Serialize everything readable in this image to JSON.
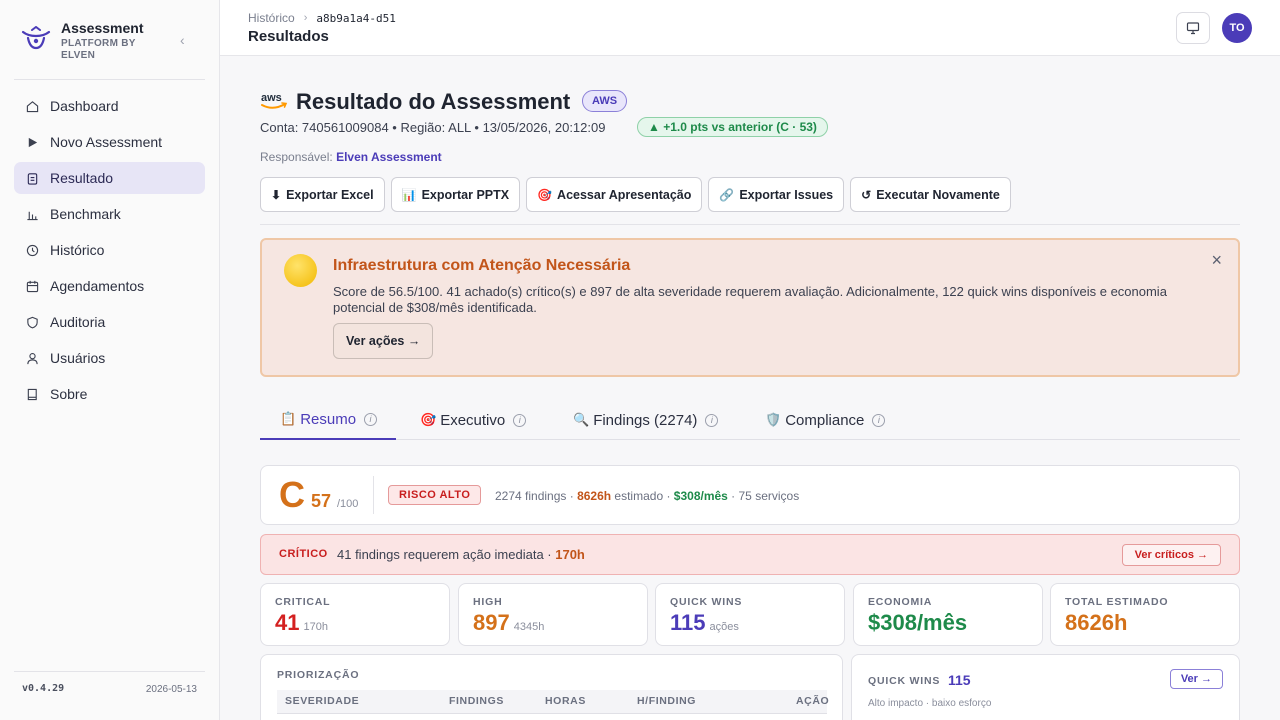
{
  "brand": {
    "title": "Assessment",
    "subtitle": "PLATFORM BY ELVEN",
    "collapse_icon": "chevron-left-icon"
  },
  "sidebar": {
    "items": [
      {
        "label": "Dashboard",
        "icon": "home-icon",
        "active": false
      },
      {
        "label": "Novo Assessment",
        "icon": "play-icon",
        "active": false
      },
      {
        "label": "Resultado",
        "icon": "clipboard-icon",
        "active": true
      },
      {
        "label": "Benchmark",
        "icon": "bar-chart-icon",
        "active": false
      },
      {
        "label": "Histórico",
        "icon": "clock-icon",
        "active": false
      },
      {
        "label": "Agendamentos",
        "icon": "calendar-icon",
        "active": false
      },
      {
        "label": "Auditoria",
        "icon": "shield-icon",
        "active": false
      },
      {
        "label": "Usuários",
        "icon": "user-icon",
        "active": false
      },
      {
        "label": "Sobre",
        "icon": "book-icon",
        "active": false
      }
    ],
    "version": "v0.4.29",
    "date": "2026-05-13"
  },
  "header": {
    "breadcrumb": {
      "parent": "Histórico",
      "current": "a8b9a1a4-d51"
    },
    "title": "Resultados",
    "avatar_initials": "TO"
  },
  "result": {
    "title": "Resultado do Assessment",
    "provider_badge": "AWS",
    "meta": "Conta: 740561009084 • Região: ALL • 13/05/2026, 20:12:09",
    "delta": "▲ +1.0 pts vs anterior (C · 53)",
    "owner_label": "Responsável:",
    "owner_name": "Elven Assessment",
    "actions": [
      {
        "icon": "⬇",
        "label": "Exportar Excel"
      },
      {
        "icon": "📊",
        "label": "Exportar PPTX"
      },
      {
        "icon": "🎯",
        "label": "Acessar Apresentação"
      },
      {
        "icon": "🔗",
        "label": "Exportar Issues"
      },
      {
        "icon": "↺",
        "label": "Executar Novamente"
      }
    ]
  },
  "alert": {
    "title": "Infraestrutura com Atenção Necessária",
    "text": "Score de 56.5/100. 41 achado(s) crítico(s) e 897 de alta severidade requerem avaliação. Adicionalmente, 122 quick wins disponíveis e economia potencial de $308/mês identificada.",
    "button": "Ver ações →",
    "close": "×"
  },
  "tabs": [
    {
      "emoji": "📋",
      "label": "Resumo",
      "active": true
    },
    {
      "emoji": "🎯",
      "label": "Executivo",
      "active": false
    },
    {
      "emoji": "🔍",
      "label": "Findings (2274)",
      "active": false
    },
    {
      "emoji": "🛡️",
      "label": "Compliance",
      "active": false
    }
  ],
  "score": {
    "grade": "C",
    "value": "57",
    "max": "/100",
    "risk": "RISCO ALTO",
    "findings": "2274 findings · ",
    "hours": "8626h",
    "hours_label": " estimado · ",
    "economy": "$308/mês",
    "services": " · 75 serviços"
  },
  "critical_bar": {
    "tag": "CRÍTICO",
    "text": "41 findings requerem ação imediata · ",
    "hours": "170h",
    "button": "Ver críticos →"
  },
  "stats": [
    {
      "label": "CRITICAL",
      "value": "41",
      "sub": "170h",
      "color": "#d42020"
    },
    {
      "label": "HIGH",
      "value": "897",
      "sub": "4345h",
      "color": "#d4711a"
    },
    {
      "label": "QUICK WINS",
      "value": "115",
      "sub": "ações",
      "color": "#4b3cb8"
    },
    {
      "label": "ECONOMIA",
      "value": "$308/mês",
      "sub": "",
      "color": "#1e8a4a"
    },
    {
      "label": "TOTAL ESTIMADO",
      "value": "8626h",
      "sub": "",
      "color": "#d4711a"
    }
  ],
  "priority": {
    "title": "PRIORIZAÇÃO",
    "columns": [
      "SEVERIDADE",
      "FINDINGS",
      "HORAS",
      "H/FINDING",
      "AÇÃO"
    ]
  },
  "quick_wins": {
    "title": "QUICK WINS",
    "count": "115",
    "subtitle": "Alto impacto · baixo esforço",
    "button": "Ver →"
  }
}
